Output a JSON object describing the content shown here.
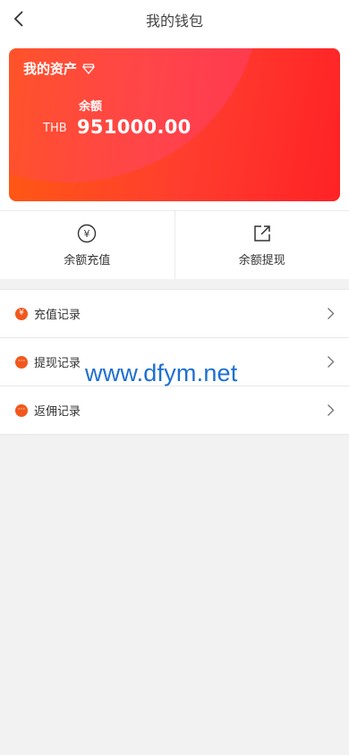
{
  "header": {
    "title": "我的钱包"
  },
  "card": {
    "assets_title": "我的资产",
    "balance_label": "余额",
    "currency": "THB",
    "amount": "951000.00",
    "gradient_start": "#ff5a12",
    "gradient_end": "#ff2226"
  },
  "actions": [
    {
      "label": "余额充值",
      "icon": "yen-circle-icon"
    },
    {
      "label": "余额提现",
      "icon": "external-link-icon"
    }
  ],
  "records": [
    {
      "label": "充值记录",
      "icon": "yen-dot-icon"
    },
    {
      "label": "提现记录",
      "icon": "ellipsis-dot-icon"
    },
    {
      "label": "返佣记录",
      "icon": "ellipsis-dot-icon"
    }
  ],
  "watermark": "www.dfym.net",
  "accent_color": "#f2581d"
}
